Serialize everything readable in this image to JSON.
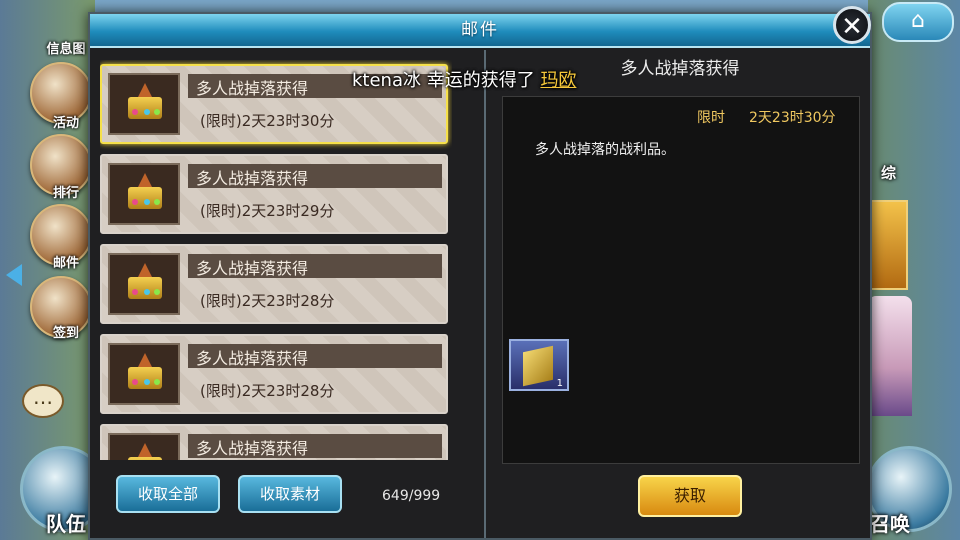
{
  "left_menu": {
    "info_label": "信息图",
    "items": [
      {
        "label": "活动",
        "icon": "event-icon"
      },
      {
        "label": "排行",
        "icon": "ranking-icon"
      },
      {
        "label": "邮件",
        "icon": "mail-icon"
      },
      {
        "label": "签到",
        "icon": "calendar-icon"
      }
    ],
    "team_label": "队伍"
  },
  "right_menu": {
    "summon_label": "召唤",
    "partial_label": "综"
  },
  "dialog": {
    "title": "邮件",
    "close_symbol": "✕"
  },
  "mail_list": [
    {
      "title": "多人战掉落获得",
      "time": "(限时)2天23时30分",
      "selected": true
    },
    {
      "title": "多人战掉落获得",
      "time": "(限时)2天23时29分",
      "selected": false
    },
    {
      "title": "多人战掉落获得",
      "time": "(限时)2天23时28分",
      "selected": false
    },
    {
      "title": "多人战掉落获得",
      "time": "(限时)2天23时28分",
      "selected": false
    },
    {
      "title": "多人战掉落获得",
      "time": "",
      "selected": false
    }
  ],
  "buttons": {
    "collect_all": "收取全部",
    "collect_materials": "收取素材",
    "collect": "获取"
  },
  "mail_count": "649/999",
  "detail": {
    "title": "多人战掉落获得",
    "limit_label": "限时",
    "limit_time": "2天23时30分",
    "description": "多人战掉落的战利品。",
    "item_count": "1"
  },
  "marquee": {
    "prefix": "ktena冰  幸运的获得了 ",
    "item": "玛欧"
  },
  "colors": {
    "title_bar": "#1f8cbc",
    "selected_border": "#f5e04a",
    "gold_button": "#f0b42a",
    "blue_button": "#2a88b8"
  }
}
